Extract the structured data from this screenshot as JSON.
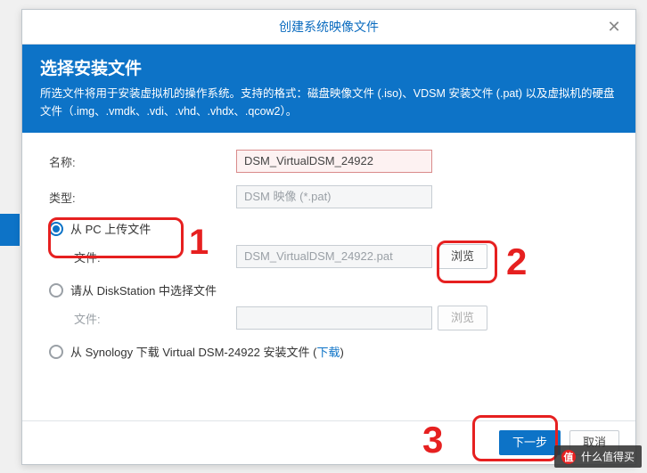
{
  "dialog": {
    "title": "创建系统映像文件",
    "close_glyph": "✕"
  },
  "header": {
    "heading": "选择安装文件",
    "desc": "所选文件将用于安装虚拟机的操作系统。支持的格式：磁盘映像文件 (.iso)、VDSM 安装文件 (.pat) 以及虚拟机的硬盘文件（.img、.vmdk、.vdi、.vhd、.vhdx、.qcow2）。"
  },
  "form": {
    "name_label": "名称:",
    "name_value": "DSM_VirtualDSM_24922",
    "type_label": "类型:",
    "type_value": "DSM 映像 (*.pat)",
    "opt_upload": "从 PC 上传文件",
    "upload_file_label": "文件:",
    "upload_file_value": "DSM_VirtualDSM_24922.pat",
    "browse_btn": "浏览",
    "opt_diskstation": "请从 DiskStation 中选择文件",
    "ds_file_label": "文件:",
    "ds_file_value": "",
    "ds_browse_btn": "浏览",
    "opt_synology_prefix": "从 Synology 下载 Virtual DSM-24922 安装文件 (",
    "opt_synology_link": "下载",
    "opt_synology_suffix": ")"
  },
  "footer": {
    "next": "下一步",
    "cancel": "取消"
  },
  "annotations": {
    "n1": "1",
    "n2": "2",
    "n3": "3"
  },
  "watermark": {
    "logo": "值",
    "text": "什么值得买"
  }
}
